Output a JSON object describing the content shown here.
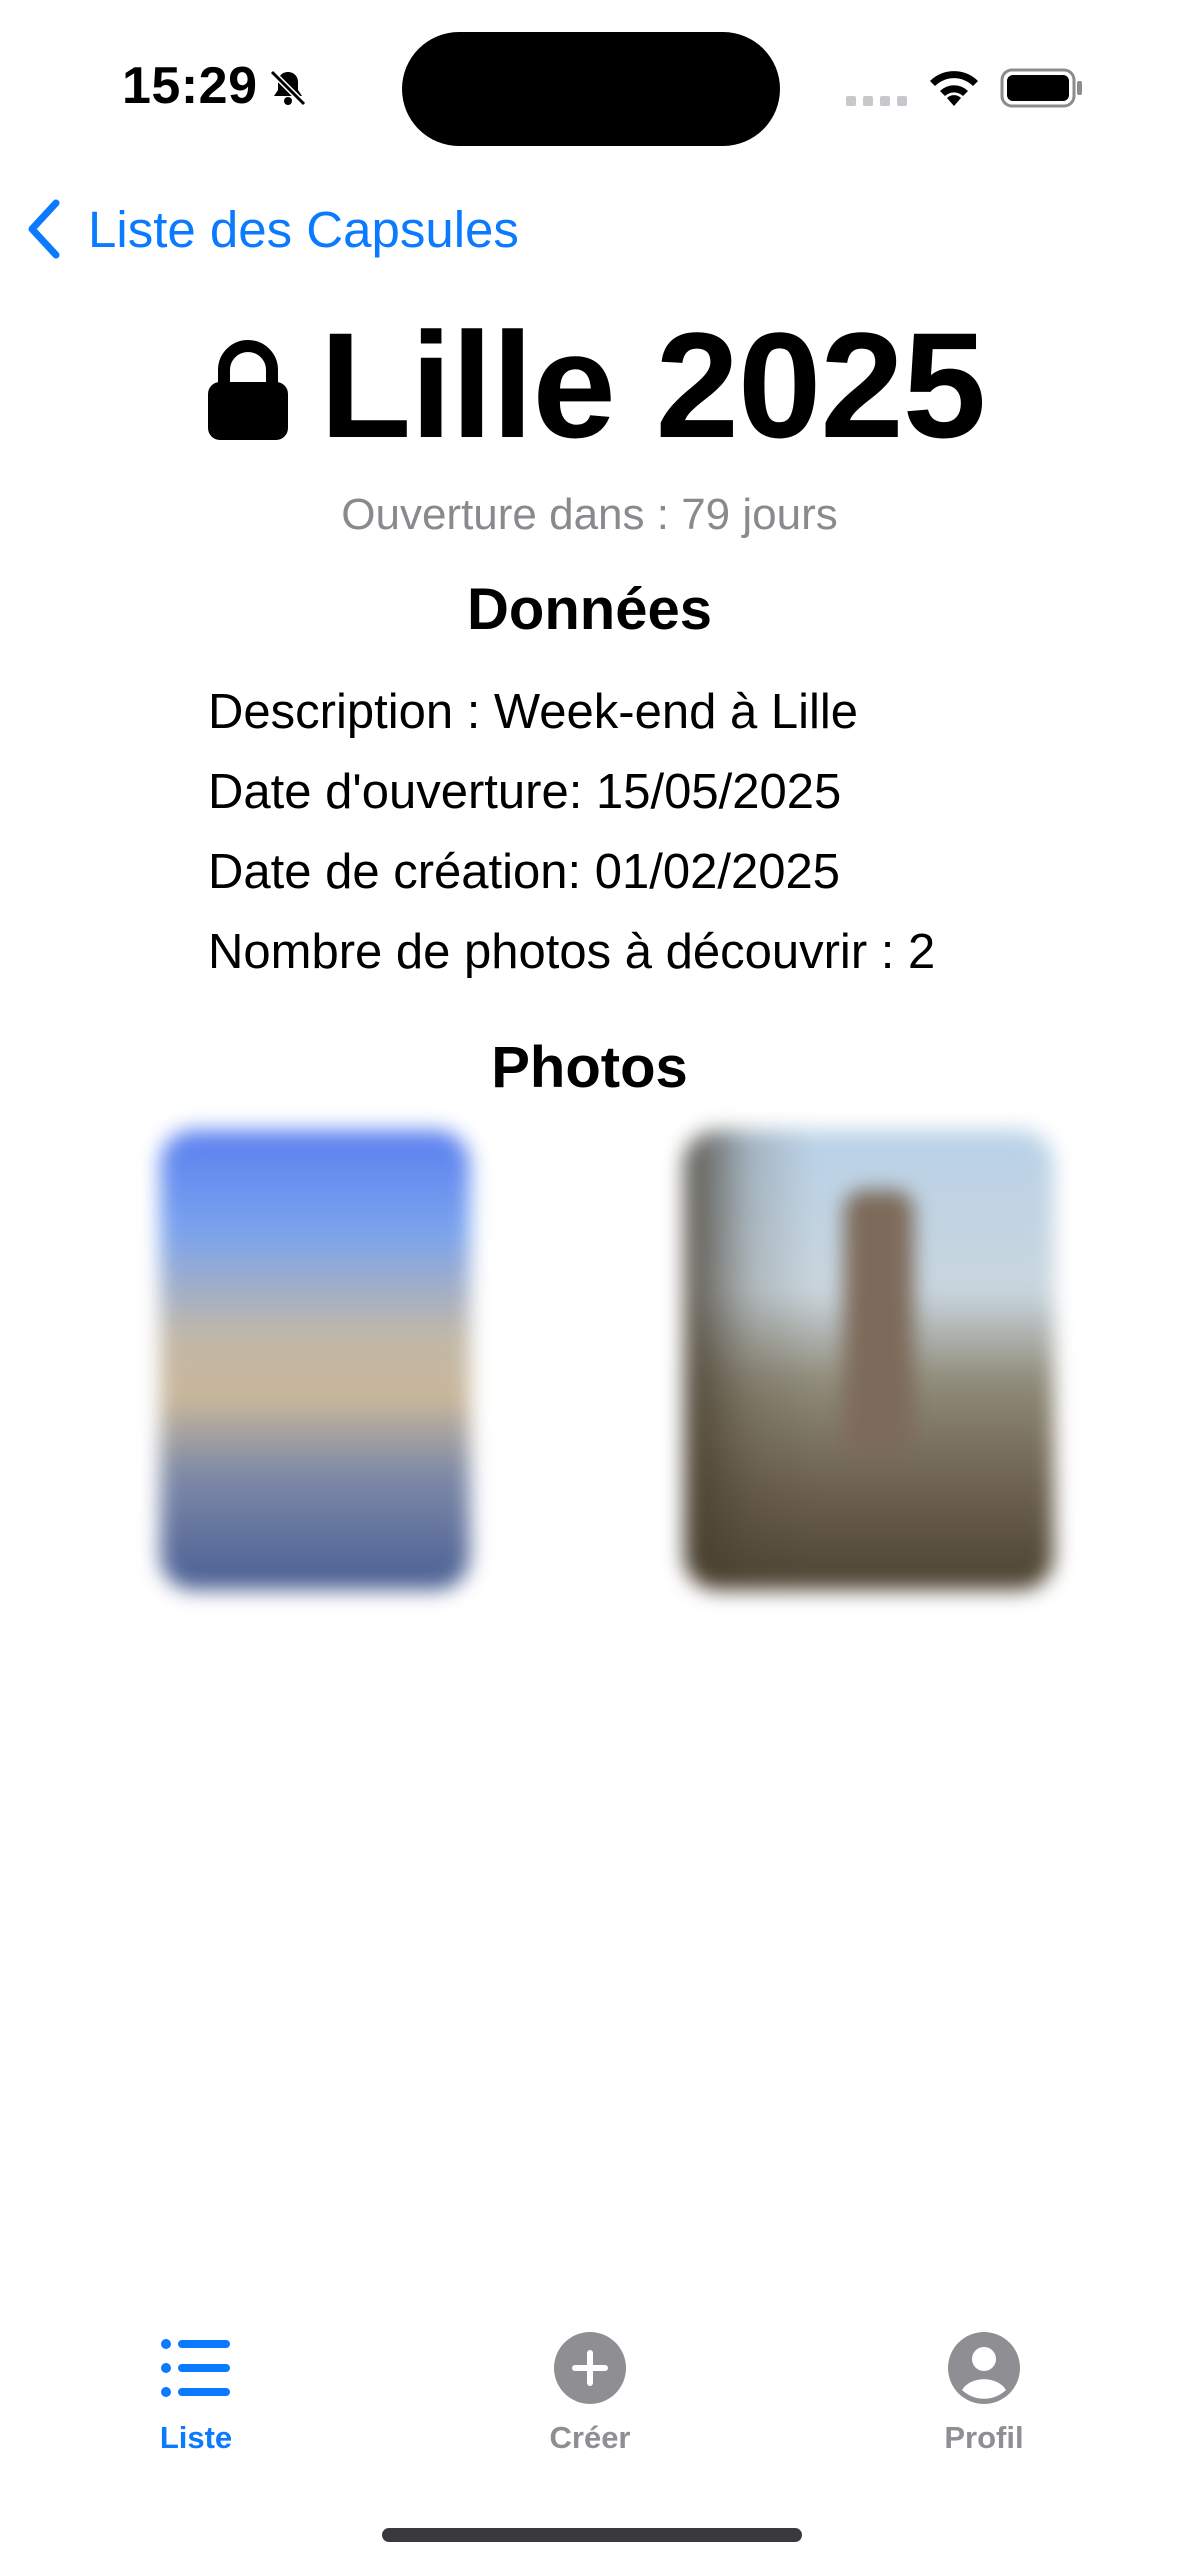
{
  "status_bar": {
    "time": "15:29"
  },
  "nav": {
    "back_label": "Liste des Capsules"
  },
  "capsule": {
    "title": "Lille 2025",
    "countdown": "Ouverture dans : 79 jours",
    "data_heading": "Données",
    "details": [
      "Description : Week-end à Lille",
      "Date d'ouverture: 15/05/2025",
      "Date de création: 01/02/2025",
      "Nombre de photos à découvrir : 2"
    ],
    "photos_heading": "Photos"
  },
  "tab_bar": {
    "items": [
      {
        "label": "Liste",
        "icon": "list-icon",
        "active": true
      },
      {
        "label": "Créer",
        "icon": "plus-circle-icon",
        "active": false
      },
      {
        "label": "Profil",
        "icon": "person-circle-icon",
        "active": false
      }
    ]
  },
  "colors": {
    "accent": "#0a7aff",
    "inactive": "#8e8e93",
    "secondary_text": "#8a8a8e"
  }
}
